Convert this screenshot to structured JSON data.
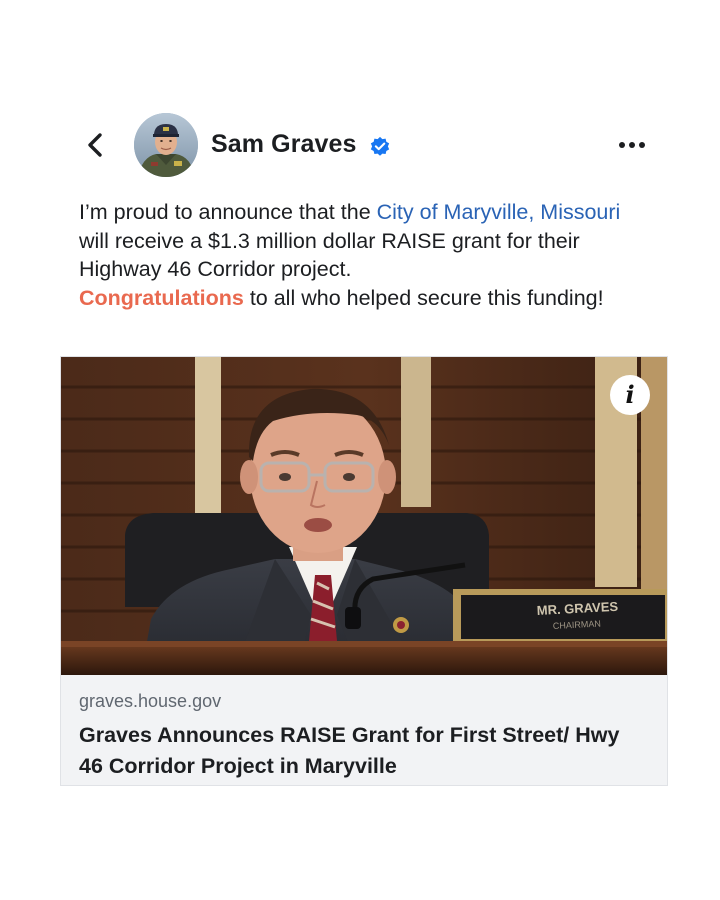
{
  "header": {
    "back_icon": "chevron-left-icon",
    "author_name": "Sam Graves",
    "verified_icon": "verified-badge-icon",
    "more_icon": "more-horizontal-icon",
    "accent_color": "#1877f2"
  },
  "post": {
    "text_1": "I’m proud to announce that the ",
    "link_text": "City of Maryville, Missouri",
    "text_2": " will receive a $1.3 million dollar RAISE grant for their Highway 46 Corridor project.",
    "highlight_text": "Congratulations",
    "text_3": " to all who helped secure this funding!",
    "link_color": "#2a63b5",
    "highlight_color": "#e9694f"
  },
  "link_preview": {
    "info_label": "i",
    "domain": "graves.house.gov",
    "title": "Graves Announces RAISE Grant for First Street/ Hwy 46 Corridor Project in Maryville",
    "nameplate_line_1": "MR. GRAVES",
    "nameplate_line_2": "CHAIRMAN"
  }
}
